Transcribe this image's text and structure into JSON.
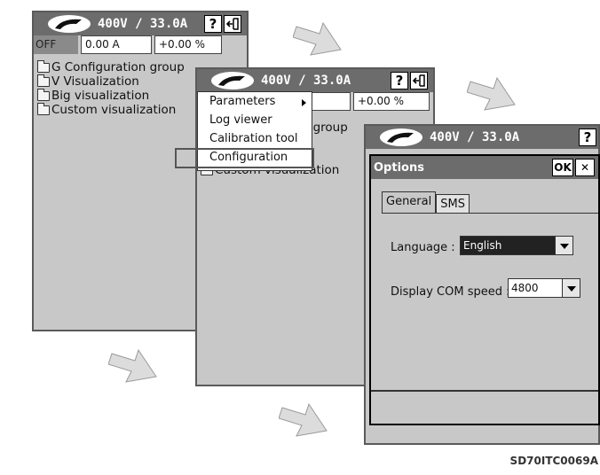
{
  "status_bar": {
    "voltage_label": "400V / 33.0A",
    "state": "OFF",
    "current_field": "0.00 A",
    "percent_field": "+0.00 %",
    "percent_field_short": "+0.00 %",
    "current_field_partial": "A"
  },
  "title_buttons": {
    "help_label": "?"
  },
  "tree": {
    "items": [
      "G Configuration group",
      "V Visualization",
      "Big visualization",
      "Custom visualization"
    ],
    "partial_group": "group"
  },
  "context_menu": {
    "items": [
      {
        "label": "Parameters",
        "has_submenu": true
      },
      {
        "label": "Log viewer",
        "has_submenu": false
      },
      {
        "label": "Calibration tool",
        "has_submenu": false
      },
      {
        "label": "Configuration",
        "has_submenu": false
      }
    ],
    "highlighted": "Configuration"
  },
  "options_dialog": {
    "title": "Options",
    "ok_label": "OK",
    "close_label": "✕",
    "tabs": [
      "General",
      "SMS"
    ],
    "active_tab": "General",
    "language_label": "Language :",
    "language_value": "English",
    "com_speed_label": "Display COM speed :",
    "com_speed_value": "4800"
  },
  "colors": {
    "titlebar": "#6c6c6c",
    "screen_bg": "#c8c8c8",
    "arrow": "#dcdcdc"
  },
  "caption": "SD70ITC0069A"
}
